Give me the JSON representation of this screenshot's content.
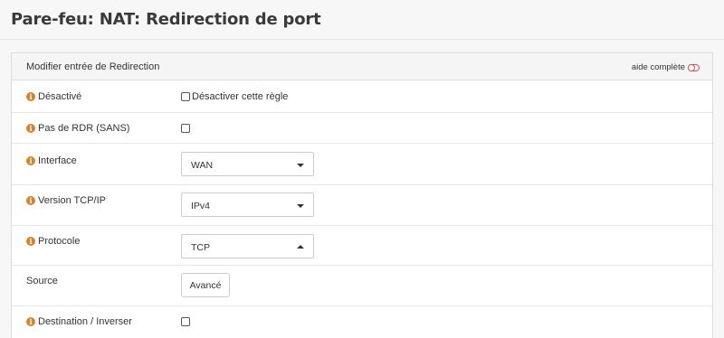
{
  "page": {
    "title": "Pare-feu: NAT: Redirection de port"
  },
  "panel": {
    "title": "Modifier entrée de Redirection",
    "help_label": "aide complète"
  },
  "rows": {
    "disabled": {
      "label": "Désactivé",
      "checkbox_label": "Désactiver cette règle",
      "checked": false
    },
    "nordr": {
      "label": "Pas de RDR (SANS)",
      "checked": false
    },
    "interface": {
      "label": "Interface",
      "value": "WAN"
    },
    "ipversion": {
      "label": "Version TCP/IP",
      "value": "IPv4"
    },
    "protocol": {
      "label": "Protocole",
      "value": "TCP"
    },
    "source": {
      "label": "Source",
      "button_label": "Avancé"
    },
    "destination": {
      "label": "Destination / Inverser",
      "checked": false
    }
  },
  "colors": {
    "info_icon": "#d9822b",
    "toggle_icon": "#d9534f"
  },
  "icons": {
    "info": "info-circle-icon",
    "help_toggle": "toggle-off-icon",
    "select_caret": "caret-down-icon"
  }
}
